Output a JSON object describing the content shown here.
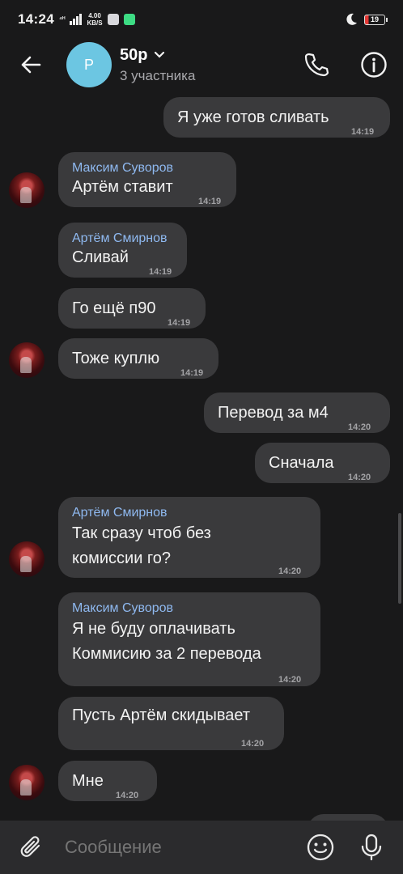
{
  "status_bar": {
    "time": "14:24",
    "network_type": "⁴ᴴ",
    "speed_value": "4.00",
    "speed_unit": "KB/S",
    "battery_level": "19"
  },
  "header": {
    "title": "50р",
    "subtitle": "3 участника",
    "avatar_letter": "Р"
  },
  "messages": [
    {
      "text": "Я уже готов сливать",
      "time": "14:19"
    },
    {
      "sender": "Максим Суворов",
      "text": "Артём ставит",
      "time": "14:19"
    },
    {
      "sender": "Артём Смирнов",
      "text": "Сливай",
      "time": "14:19"
    },
    {
      "text": "Го ещё п90",
      "time": "14:19"
    },
    {
      "text": "Тоже куплю",
      "time": "14:19"
    },
    {
      "text": "Перевод за м4",
      "time": "14:20"
    },
    {
      "text": "Сначала",
      "time": "14:20"
    },
    {
      "sender": "Артём Смирнов",
      "line1": "Так сразу чтоб без",
      "line2": "комиссии го?",
      "time": "14:20"
    },
    {
      "sender": "Максим Суворов",
      "line1": "Я не буду оплачивать",
      "line2": "Коммисию за 2 перевода",
      "time": "14:20"
    },
    {
      "text": "Пусть Артём скидывает",
      "time": "14:20"
    },
    {
      "text": "Мне",
      "time": "14:20"
    }
  ],
  "input": {
    "placeholder": "Сообщение"
  },
  "colors": {
    "background": "#19191a",
    "bubble": "#3a3a3c",
    "sender_name": "#8fb9f0",
    "group_avatar": "#6cc6e2",
    "input_bar": "#2b2b2d"
  },
  "icons": [
    "back-arrow-icon",
    "chevron-down-icon",
    "phone-icon",
    "info-icon",
    "paperclip-icon",
    "emoji-icon",
    "microphone-icon",
    "moon-icon",
    "battery-icon"
  ]
}
